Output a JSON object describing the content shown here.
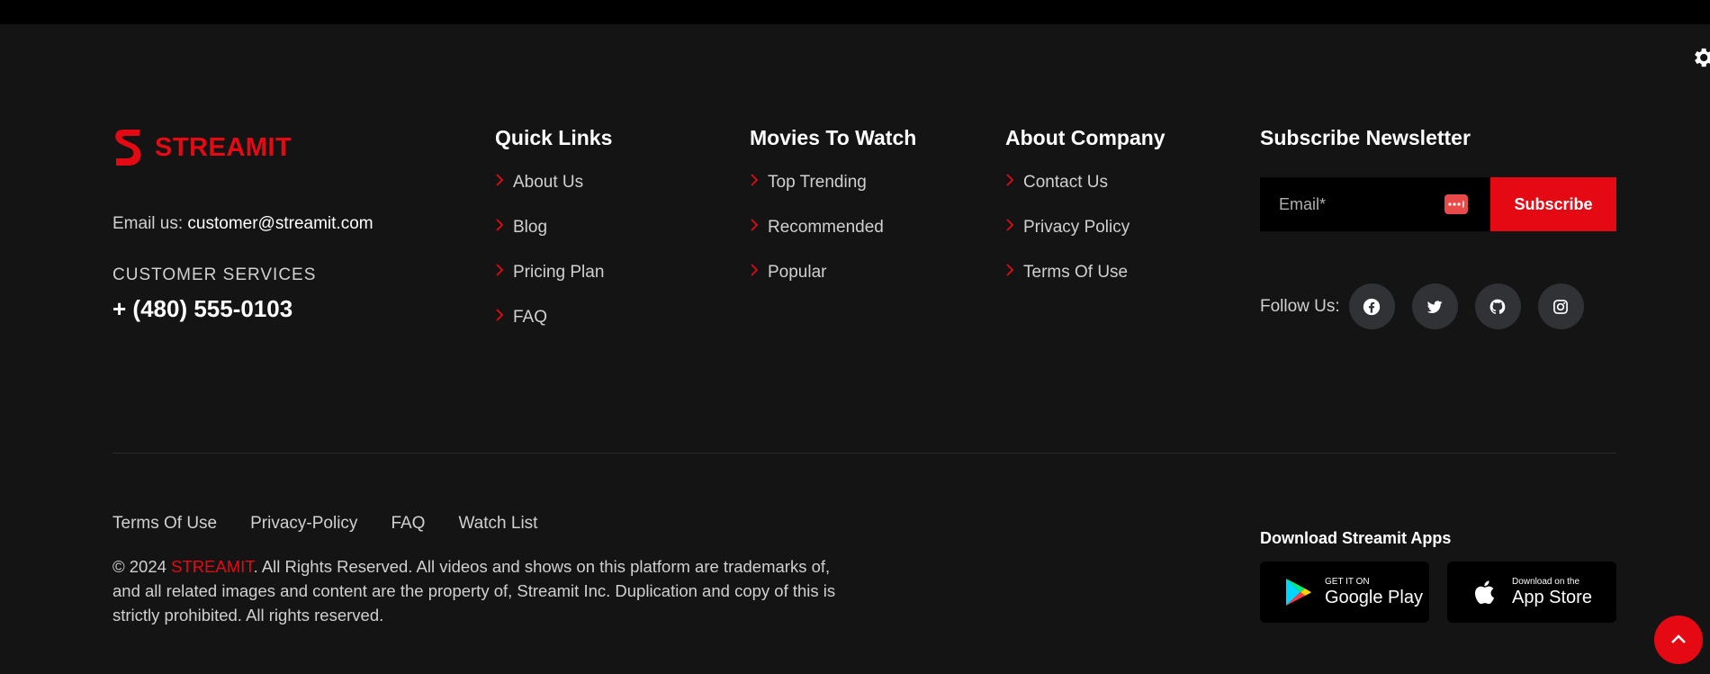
{
  "brand": {
    "name": "STREAMIT"
  },
  "contact": {
    "email_label": "Email us:",
    "email_value": "customer@streamit.com",
    "customer_services_label": "CUSTOMER SERVICES",
    "phone": "+ (480) 555-0103"
  },
  "columns": [
    {
      "title": "Quick Links",
      "items": [
        "About Us",
        "Blog",
        "Pricing Plan",
        "FAQ"
      ]
    },
    {
      "title": "Movies To Watch",
      "items": [
        "Top Trending",
        "Recommended",
        "Popular"
      ]
    },
    {
      "title": "About Company",
      "items": [
        "Contact Us",
        "Privacy Policy",
        "Terms Of Use"
      ]
    }
  ],
  "newsletter": {
    "title": "Subscribe Newsletter",
    "email_placeholder": "Email*",
    "email_value": "",
    "button_label": "Subscribe"
  },
  "follow": {
    "label": "Follow Us:",
    "icons": [
      "facebook-icon",
      "twitter-icon",
      "github-icon",
      "instagram-icon"
    ]
  },
  "bottom_links": [
    "Terms Of Use",
    "Privacy-Policy",
    "FAQ",
    "Watch List"
  ],
  "copyright": {
    "prefix": "© 2024 ",
    "brand": "STREAMIT",
    "suffix": ". All Rights Reserved. All videos and shows on this platform are trademarks of, and all related images and content are the property of, Streamit Inc. Duplication and copy of this is strictly prohibited. All rights reserved."
  },
  "apps": {
    "title": "Download Streamit Apps",
    "google_play": {
      "small": "GET IT ON",
      "big": "Google Play"
    },
    "app_store": {
      "small": "Download on the",
      "big": "App Store"
    }
  },
  "colors": {
    "accent": "#e50914",
    "background": "#141414",
    "social_bg": "#303236"
  }
}
